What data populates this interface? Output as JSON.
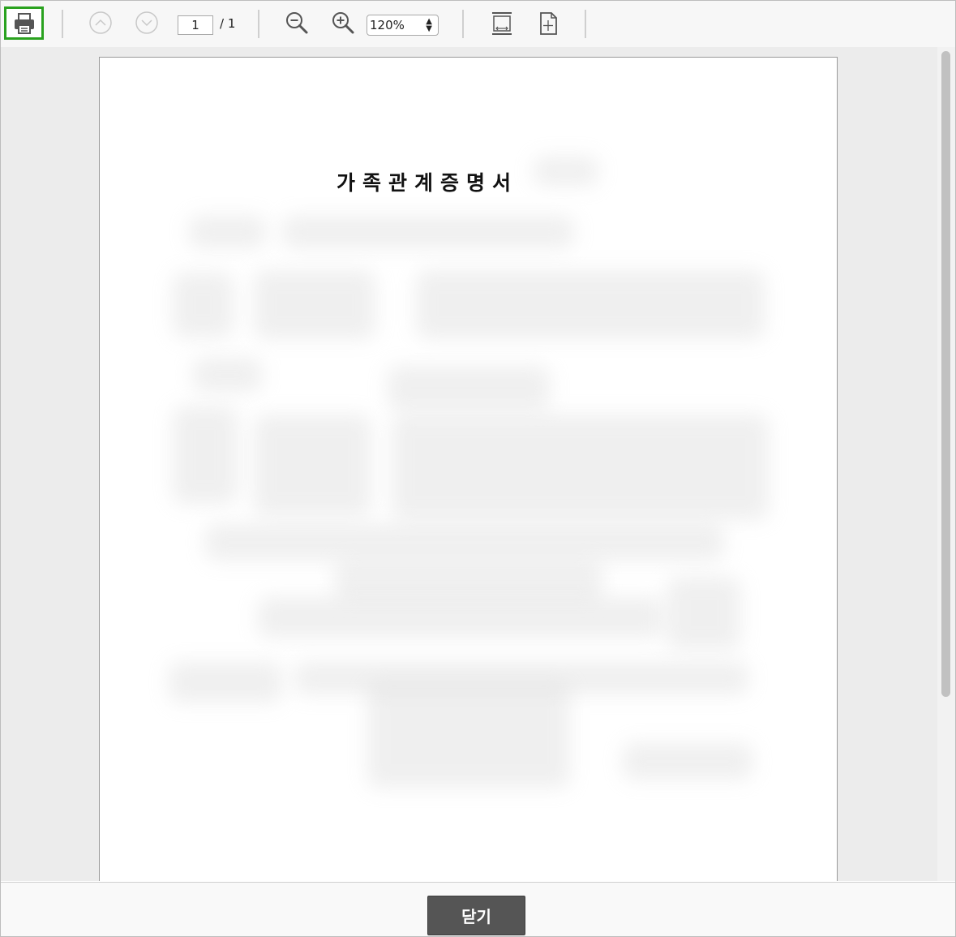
{
  "toolbar": {
    "print_icon": "printer-icon",
    "prev_icon": "chevron-up-circle-icon",
    "next_icon": "chevron-down-circle-icon",
    "current_page": "1",
    "page_total": "/ 1",
    "zoom_out_icon": "zoom-out-icon",
    "zoom_in_icon": "zoom-in-icon",
    "zoom_level": "120%",
    "fit_width_icon": "fit-width-icon",
    "fit_page_icon": "fit-page-icon"
  },
  "document": {
    "title": "가족관계증명서"
  },
  "footer": {
    "close_label": "닫기"
  },
  "colors": {
    "print_highlight": "#2aa21f",
    "close_button": "#555555",
    "viewer_background": "#ececec"
  }
}
